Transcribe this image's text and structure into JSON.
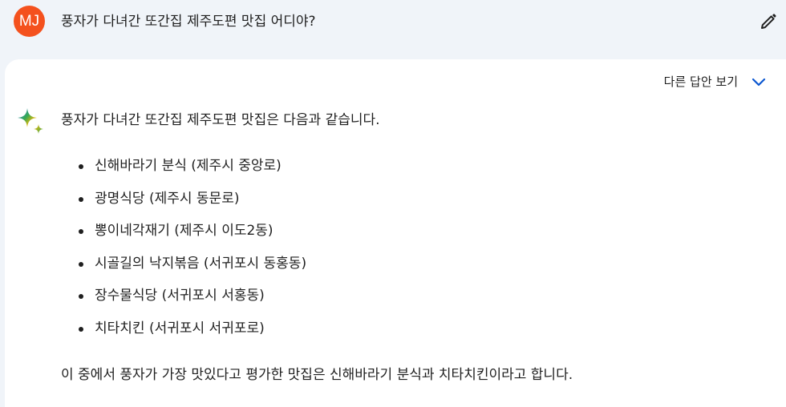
{
  "user": {
    "initials": "MJ",
    "avatar_color": "#f4511e"
  },
  "prompt": {
    "text": "풍자가 다녀간 또간집 제주도편 맛집 어디야?",
    "edit_icon": "pencil-icon"
  },
  "response": {
    "drafts_label": "다른 답안 보기",
    "drafts_icon": "chevron-down-icon",
    "drafts_icon_color": "#0b57d0",
    "assistant_icon": "sparkle-icon",
    "intro": "풍자가 다녀간 또간집 제주도편 맛집은 다음과 같습니다.",
    "items": [
      {
        "text": "신해바라기 분식 (제주시 중앙로)"
      },
      {
        "text": "광명식당 (제주시 동문로)"
      },
      {
        "text": "뽕이네각재기 (제주시 이도2동)"
      },
      {
        "text": "시골길의 낙지볶음 (서귀포시 동홍동)"
      },
      {
        "text": "장수물식당 (서귀포시 서홍동)"
      },
      {
        "text": "치타치킨 (서귀포시 서귀포로)"
      }
    ],
    "summary": "이 중에서 풍자가 가장 맛있다고 평가한 맛집은 신해바라기 분식과 치타치킨이라고 합니다."
  },
  "colors": {
    "page_background": "#f0f4f9",
    "card_background": "#ffffff",
    "text": "#1f1f1f"
  }
}
